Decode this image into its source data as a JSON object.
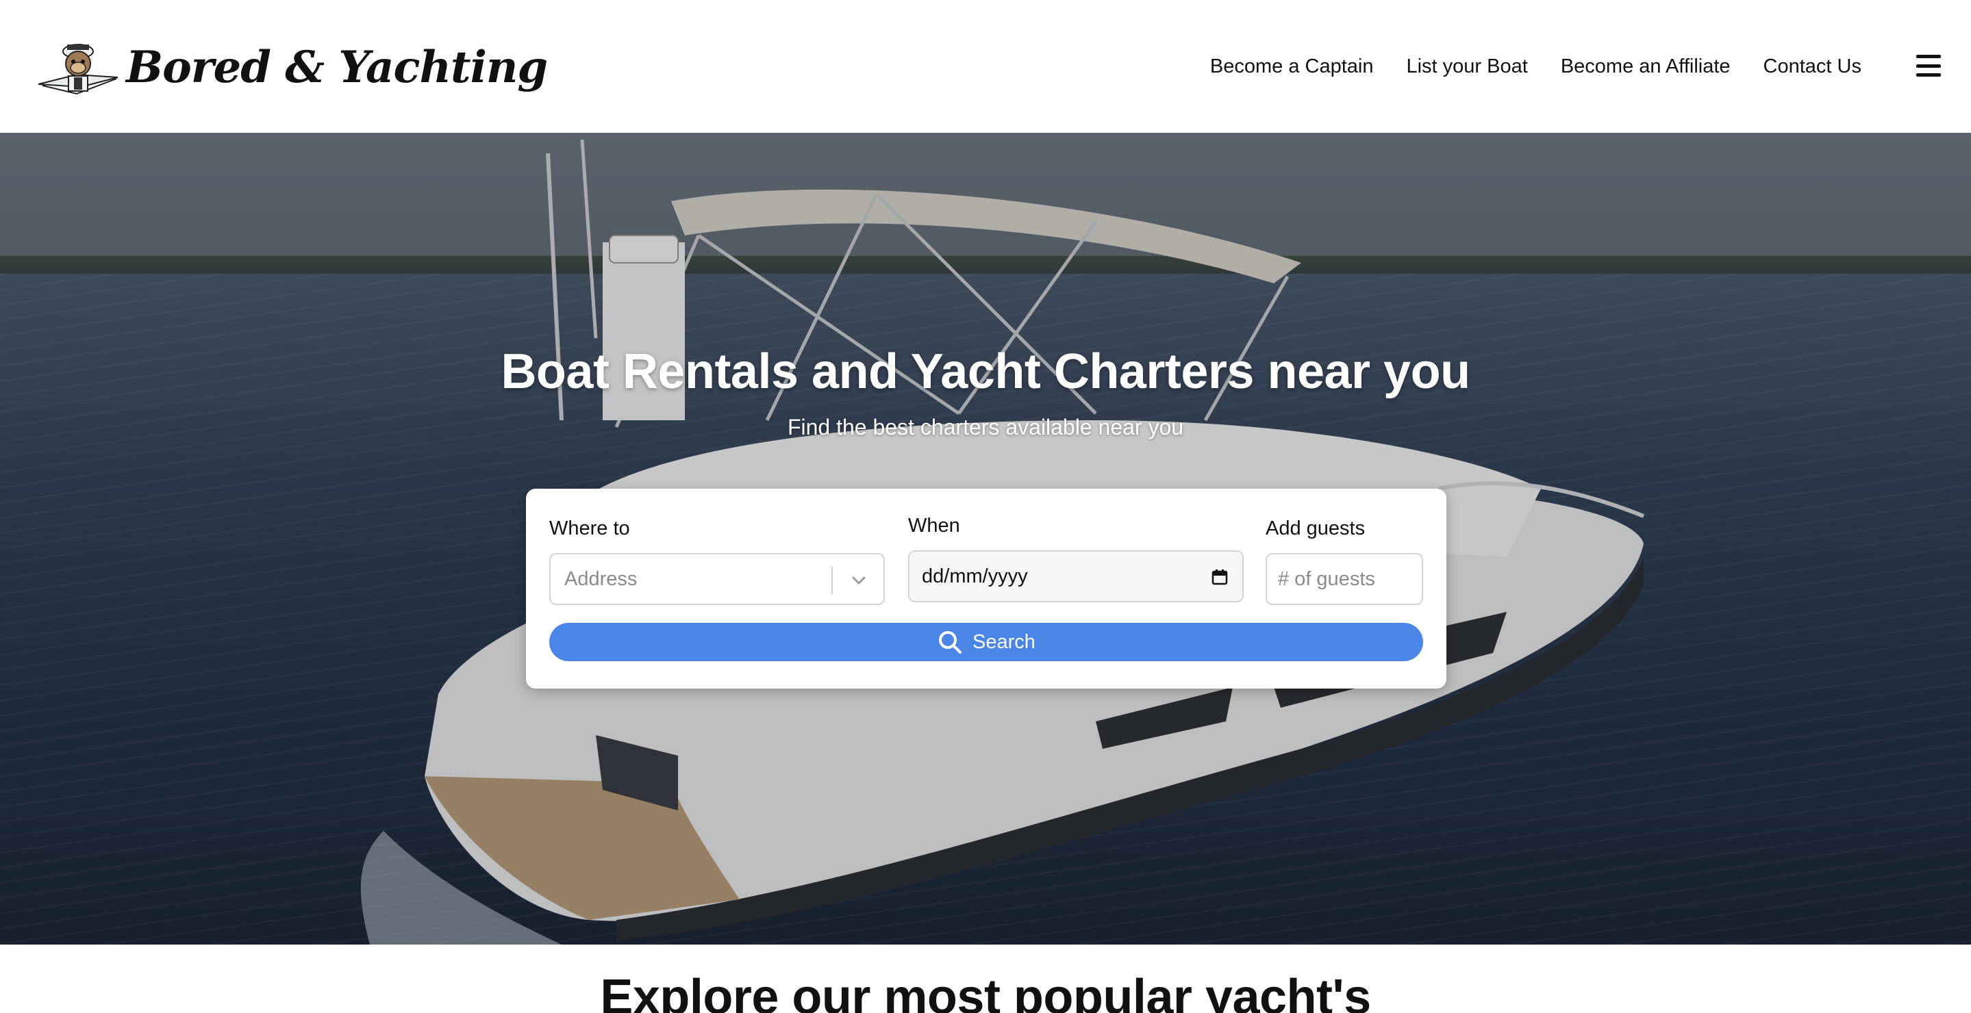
{
  "brand": {
    "name": "Bored & Yachting"
  },
  "nav": {
    "links": [
      {
        "label": "Become a Captain"
      },
      {
        "label": "List your Boat"
      },
      {
        "label": "Become an Affiliate"
      },
      {
        "label": "Contact Us"
      }
    ],
    "menu_icon": "hamburger-icon"
  },
  "hero": {
    "title": "Boat Rentals and Yacht Charters near you",
    "subtitle": "Find the best charters available near you"
  },
  "search": {
    "where_label": "Where to",
    "where_placeholder": "Address",
    "when_label": "When",
    "when_value": "dd/mm/yyyy",
    "guests_label": "Add guests",
    "guests_placeholder": "# of guests",
    "button_label": "Search",
    "button_icon": "search-icon",
    "accent_color": "#4a86e8"
  },
  "section": {
    "title": "Explore our most popular yacht's"
  }
}
